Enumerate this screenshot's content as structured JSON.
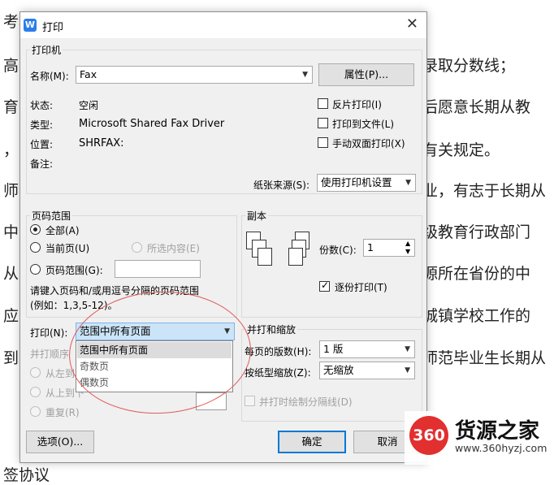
{
  "background_doc": {
    "left_chars": [
      "考",
      "高",
      "育",
      "，",
      "师",
      "中",
      "从",
      "应",
      "到"
    ],
    "right_fragments": [
      "录取分数线；",
      "后愿意长期从教",
      "有关规定。",
      "业，有志于长期从",
      "级教育行政部门",
      "源所在省份的中",
      "城镇学校工作的",
      "师范毕业生长期从"
    ],
    "bottom_fragment": "签协议"
  },
  "dialog": {
    "title": "打印",
    "app_icon_letter": "W",
    "close_glyph": "✕",
    "printer": {
      "group_title": "打印机",
      "name_label": "名称(M):",
      "name_value": "Fax",
      "properties_button": "属性(P)...",
      "status_label": "状态:",
      "status_value": "空闲",
      "type_label": "类型:",
      "type_value": "Microsoft Shared Fax Driver",
      "location_label": "位置:",
      "location_value": "SHRFAX:",
      "comment_label": "备注:",
      "comment_value": "",
      "reverse_print": "反片打印(I)",
      "print_to_file": "打印到文件(L)",
      "manual_duplex": "手动双面打印(X)",
      "paper_source_label": "纸张来源(S):",
      "paper_source_value": "使用打印机设置"
    },
    "page_range": {
      "group_title": "页码范围",
      "all": "全部(A)",
      "current_page": "当前页(U)",
      "selection": "所选内容(E)",
      "pages": "页码范围(G):",
      "pages_value": "",
      "hint_line1": "请键入页码和/或用逗号分隔的页码范围",
      "hint_line2": "(例如：1,3,5-12)。"
    },
    "copies": {
      "group_title": "副本",
      "count_label": "份数(C):",
      "count_value": "1",
      "collate": "逐份打印(T)"
    },
    "print_what": {
      "label": "打印(N):",
      "value": "范围中所有页面",
      "options": [
        "范围中所有页面",
        "奇数页",
        "偶数页"
      ]
    },
    "order": {
      "label": "并打顺序",
      "left_to_right": "从左到右",
      "top_to_bottom": "从上到下",
      "repeat": "重复(R)"
    },
    "zoom": {
      "group_title": "并打和缩放",
      "pages_per_sheet_label": "每页的版数(H):",
      "pages_per_sheet_value": "1 版",
      "scale_label": "按纸型缩放(Z):",
      "scale_value": "无缩放",
      "draw_borders": "并打时绘制分隔线(D)"
    },
    "buttons": {
      "options": "选项(O)...",
      "ok": "确定",
      "cancel": "取消"
    }
  },
  "watermark": {
    "logo_text": "360",
    "title": "货源之家",
    "url": "www.360hyzj.com"
  },
  "colors": {
    "accent": "#0078d7",
    "annotation_ellipse": "#e05a5a",
    "watermark_red": "#e22f2f"
  }
}
